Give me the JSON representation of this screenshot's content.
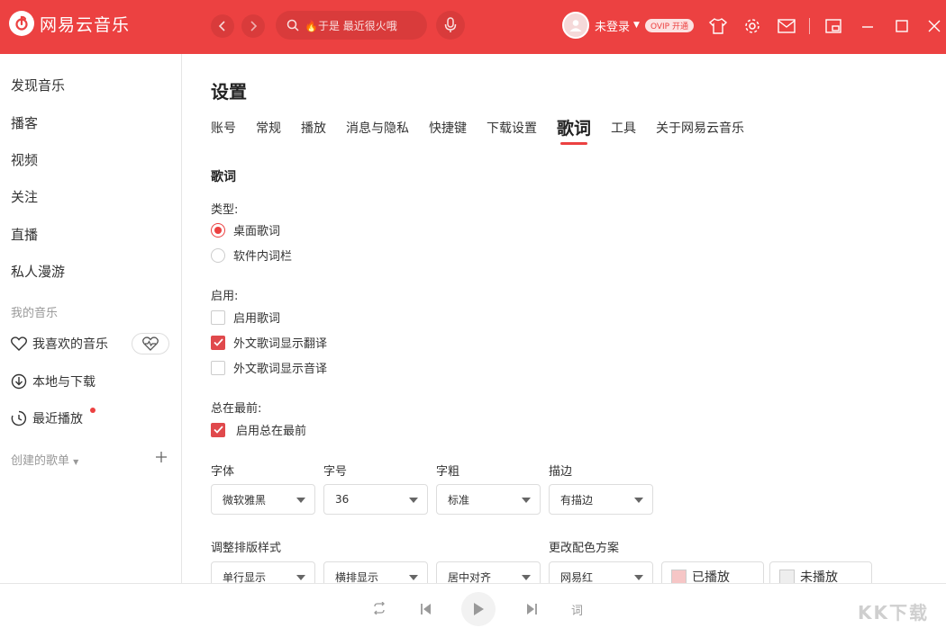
{
  "app": {
    "title": "网易云音乐"
  },
  "search": {
    "placeholder": "于是 最近很火哦"
  },
  "user": {
    "name": "未登录",
    "vip_badge": "OVIP 开通"
  },
  "sidebar": {
    "items": [
      {
        "label": "发现音乐"
      },
      {
        "label": "播客"
      },
      {
        "label": "视频"
      },
      {
        "label": "关注"
      },
      {
        "label": "直播"
      },
      {
        "label": "私人漫游"
      }
    ],
    "my_music_title": "我的音乐",
    "my_music": [
      {
        "label": "我喜欢的音乐",
        "icon": "heart-icon"
      },
      {
        "label": "本地与下载",
        "icon": "download-icon"
      },
      {
        "label": "最近播放",
        "icon": "recent-icon"
      }
    ],
    "created_playlists": "创建的歌单"
  },
  "settings": {
    "title": "设置",
    "tabs": [
      "账号",
      "常规",
      "播放",
      "消息与隐私",
      "快捷键",
      "下载设置",
      "歌词",
      "工具",
      "关于网易云音乐"
    ],
    "active_tab": "歌词",
    "section_title": "歌词",
    "type_label": "类型:",
    "type_options": [
      {
        "label": "桌面歌词",
        "selected": true
      },
      {
        "label": "软件内词栏",
        "selected": false
      }
    ],
    "enable_label": "启用:",
    "enable_options": [
      {
        "label": "启用歌词",
        "checked": false
      },
      {
        "label": "外文歌词显示翻译",
        "checked": true
      },
      {
        "label": "外文歌词显示音译",
        "checked": false
      }
    ],
    "ontop_label": "总在最前:",
    "ontop_option": {
      "label": "启用总在最前",
      "checked": true
    },
    "font_label": "字体",
    "font_value": "微软雅黑",
    "size_label": "字号",
    "size_value": "36",
    "weight_label": "字粗",
    "weight_value": "标准",
    "stroke_label": "描边",
    "stroke_value": "有描边",
    "layout_label": "调整排版样式",
    "layout_values": [
      "单行显示",
      "横排显示",
      "居中对齐"
    ],
    "color_label": "更改配色方案",
    "color_value": "网易红",
    "played_label": "已播放",
    "unplayed_label": "未播放"
  },
  "player": {
    "lyric_label": "词"
  },
  "watermark": "KK下载",
  "colors": {
    "accent": "#ec4141",
    "played_swatch": "#f6c6c6",
    "unplayed_swatch": "#eeeeee"
  }
}
